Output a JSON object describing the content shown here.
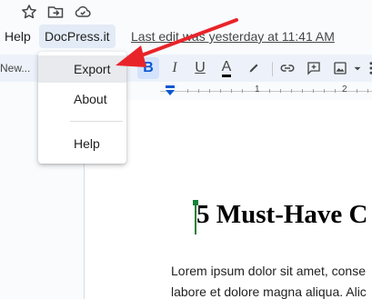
{
  "top_icons": [
    {
      "name": "star-icon"
    },
    {
      "name": "move-folder-icon"
    },
    {
      "name": "cloud-status-icon"
    }
  ],
  "menubar": {
    "help": "Help",
    "docpress": "DocPress.it",
    "last_edit": "Last edit was yesterday at 11:41 AM"
  },
  "toolbar": {
    "font": "New...",
    "bold": "B",
    "italic": "I",
    "underline": "U",
    "text_color": "A"
  },
  "ruler": {
    "numbers": [
      "1",
      "2"
    ]
  },
  "dropdown": {
    "items": [
      {
        "label": "Export"
      },
      {
        "label": "About"
      },
      {
        "label": "Help"
      }
    ]
  },
  "document": {
    "heading": "5 Must-Have C",
    "lines": [
      "Lorem ipsum dolor sit amet, conse",
      "labore et dolore magna aliqua. Alic"
    ]
  },
  "colors": {
    "accent": "#0b57d0",
    "arrow": "#e8242a",
    "cursor": "#188038"
  }
}
